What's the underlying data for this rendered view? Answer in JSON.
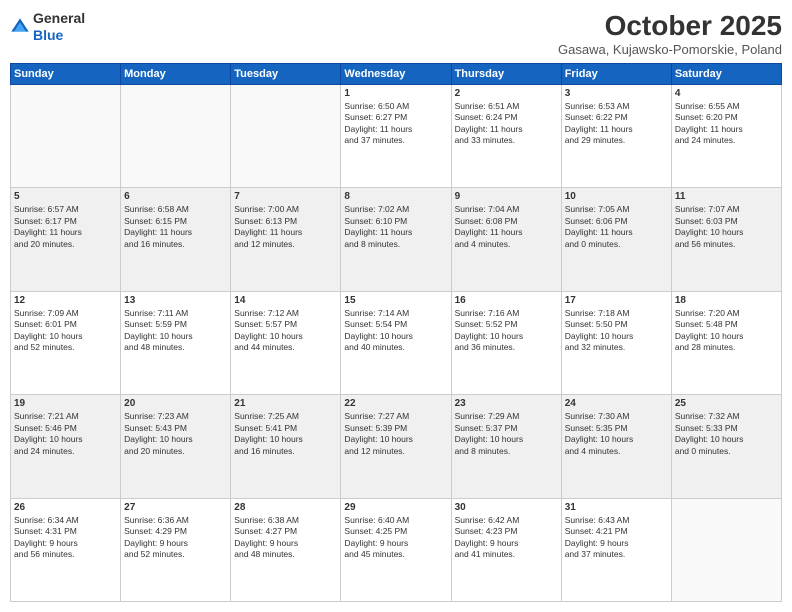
{
  "logo": {
    "general": "General",
    "blue": "Blue"
  },
  "title": "October 2025",
  "location": "Gasawa, Kujawsko-Pomorskie, Poland",
  "days_header": [
    "Sunday",
    "Monday",
    "Tuesday",
    "Wednesday",
    "Thursday",
    "Friday",
    "Saturday"
  ],
  "weeks": [
    [
      {
        "num": "",
        "info": ""
      },
      {
        "num": "",
        "info": ""
      },
      {
        "num": "",
        "info": ""
      },
      {
        "num": "1",
        "info": "Sunrise: 6:50 AM\nSunset: 6:27 PM\nDaylight: 11 hours\nand 37 minutes."
      },
      {
        "num": "2",
        "info": "Sunrise: 6:51 AM\nSunset: 6:24 PM\nDaylight: 11 hours\nand 33 minutes."
      },
      {
        "num": "3",
        "info": "Sunrise: 6:53 AM\nSunset: 6:22 PM\nDaylight: 11 hours\nand 29 minutes."
      },
      {
        "num": "4",
        "info": "Sunrise: 6:55 AM\nSunset: 6:20 PM\nDaylight: 11 hours\nand 24 minutes."
      }
    ],
    [
      {
        "num": "5",
        "info": "Sunrise: 6:57 AM\nSunset: 6:17 PM\nDaylight: 11 hours\nand 20 minutes."
      },
      {
        "num": "6",
        "info": "Sunrise: 6:58 AM\nSunset: 6:15 PM\nDaylight: 11 hours\nand 16 minutes."
      },
      {
        "num": "7",
        "info": "Sunrise: 7:00 AM\nSunset: 6:13 PM\nDaylight: 11 hours\nand 12 minutes."
      },
      {
        "num": "8",
        "info": "Sunrise: 7:02 AM\nSunset: 6:10 PM\nDaylight: 11 hours\nand 8 minutes."
      },
      {
        "num": "9",
        "info": "Sunrise: 7:04 AM\nSunset: 6:08 PM\nDaylight: 11 hours\nand 4 minutes."
      },
      {
        "num": "10",
        "info": "Sunrise: 7:05 AM\nSunset: 6:06 PM\nDaylight: 11 hours\nand 0 minutes."
      },
      {
        "num": "11",
        "info": "Sunrise: 7:07 AM\nSunset: 6:03 PM\nDaylight: 10 hours\nand 56 minutes."
      }
    ],
    [
      {
        "num": "12",
        "info": "Sunrise: 7:09 AM\nSunset: 6:01 PM\nDaylight: 10 hours\nand 52 minutes."
      },
      {
        "num": "13",
        "info": "Sunrise: 7:11 AM\nSunset: 5:59 PM\nDaylight: 10 hours\nand 48 minutes."
      },
      {
        "num": "14",
        "info": "Sunrise: 7:12 AM\nSunset: 5:57 PM\nDaylight: 10 hours\nand 44 minutes."
      },
      {
        "num": "15",
        "info": "Sunrise: 7:14 AM\nSunset: 5:54 PM\nDaylight: 10 hours\nand 40 minutes."
      },
      {
        "num": "16",
        "info": "Sunrise: 7:16 AM\nSunset: 5:52 PM\nDaylight: 10 hours\nand 36 minutes."
      },
      {
        "num": "17",
        "info": "Sunrise: 7:18 AM\nSunset: 5:50 PM\nDaylight: 10 hours\nand 32 minutes."
      },
      {
        "num": "18",
        "info": "Sunrise: 7:20 AM\nSunset: 5:48 PM\nDaylight: 10 hours\nand 28 minutes."
      }
    ],
    [
      {
        "num": "19",
        "info": "Sunrise: 7:21 AM\nSunset: 5:46 PM\nDaylight: 10 hours\nand 24 minutes."
      },
      {
        "num": "20",
        "info": "Sunrise: 7:23 AM\nSunset: 5:43 PM\nDaylight: 10 hours\nand 20 minutes."
      },
      {
        "num": "21",
        "info": "Sunrise: 7:25 AM\nSunset: 5:41 PM\nDaylight: 10 hours\nand 16 minutes."
      },
      {
        "num": "22",
        "info": "Sunrise: 7:27 AM\nSunset: 5:39 PM\nDaylight: 10 hours\nand 12 minutes."
      },
      {
        "num": "23",
        "info": "Sunrise: 7:29 AM\nSunset: 5:37 PM\nDaylight: 10 hours\nand 8 minutes."
      },
      {
        "num": "24",
        "info": "Sunrise: 7:30 AM\nSunset: 5:35 PM\nDaylight: 10 hours\nand 4 minutes."
      },
      {
        "num": "25",
        "info": "Sunrise: 7:32 AM\nSunset: 5:33 PM\nDaylight: 10 hours\nand 0 minutes."
      }
    ],
    [
      {
        "num": "26",
        "info": "Sunrise: 6:34 AM\nSunset: 4:31 PM\nDaylight: 9 hours\nand 56 minutes."
      },
      {
        "num": "27",
        "info": "Sunrise: 6:36 AM\nSunset: 4:29 PM\nDaylight: 9 hours\nand 52 minutes."
      },
      {
        "num": "28",
        "info": "Sunrise: 6:38 AM\nSunset: 4:27 PM\nDaylight: 9 hours\nand 48 minutes."
      },
      {
        "num": "29",
        "info": "Sunrise: 6:40 AM\nSunset: 4:25 PM\nDaylight: 9 hours\nand 45 minutes."
      },
      {
        "num": "30",
        "info": "Sunrise: 6:42 AM\nSunset: 4:23 PM\nDaylight: 9 hours\nand 41 minutes."
      },
      {
        "num": "31",
        "info": "Sunrise: 6:43 AM\nSunset: 4:21 PM\nDaylight: 9 hours\nand 37 minutes."
      },
      {
        "num": "",
        "info": ""
      }
    ]
  ]
}
